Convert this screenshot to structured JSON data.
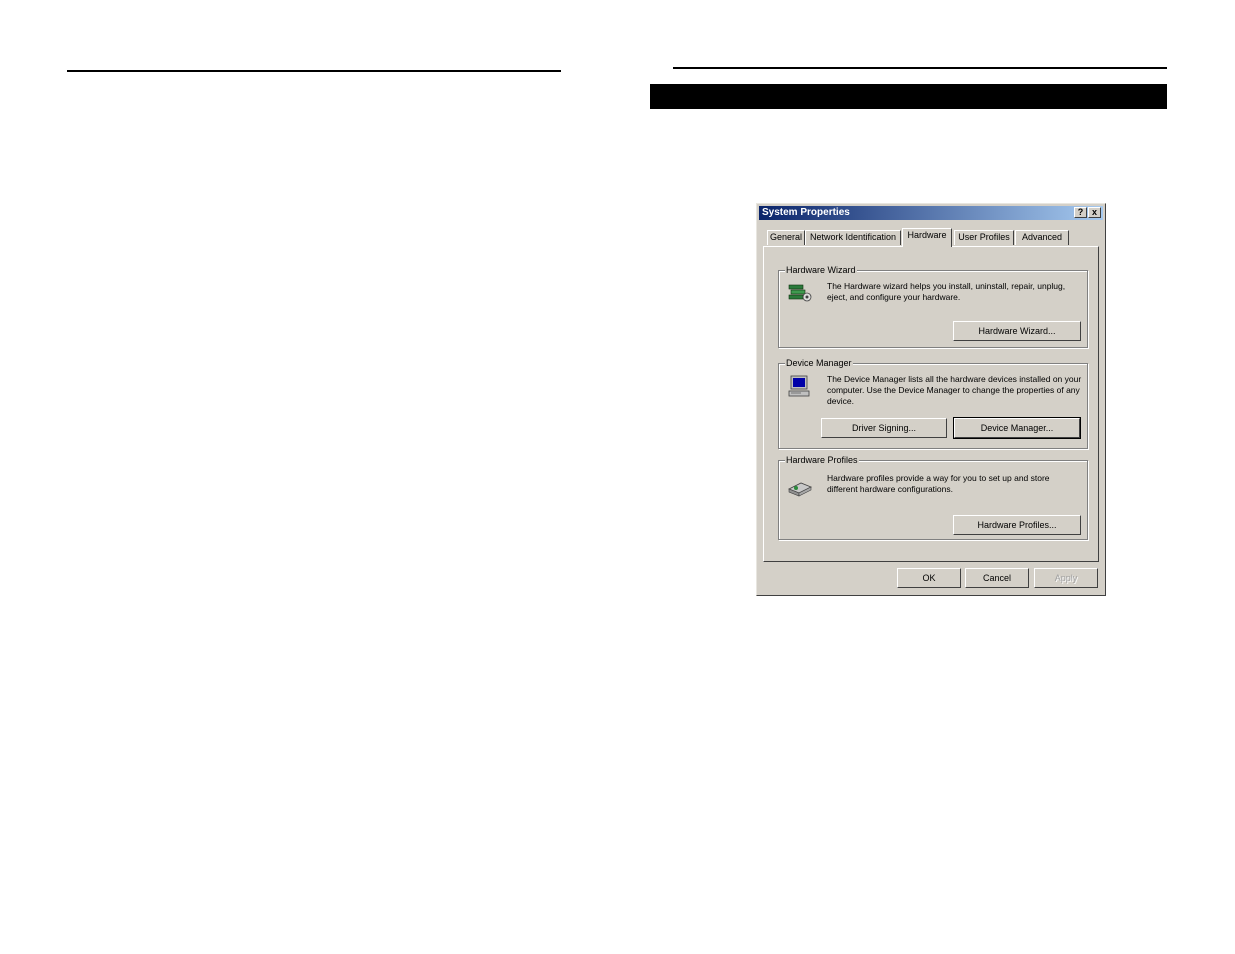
{
  "dialog": {
    "title": "System Properties",
    "help_label": "?",
    "close_label": "x"
  },
  "tabs": [
    "General",
    "Network Identification",
    "Hardware",
    "User Profiles",
    "Advanced"
  ],
  "active_tab": "Hardware",
  "groups": {
    "hardware_wizard": {
      "legend": "Hardware Wizard",
      "description": "The Hardware wizard helps you install, uninstall, repair, unplug, eject, and configure your hardware.",
      "button": "Hardware Wizard..."
    },
    "device_manager": {
      "legend": "Device Manager",
      "description": "The Device Manager lists all the hardware devices installed on your computer. Use the Device Manager to change the properties of any device.",
      "driver_signing_button": "Driver Signing...",
      "device_manager_button": "Device Manager..."
    },
    "hardware_profiles": {
      "legend": "Hardware Profiles",
      "description": "Hardware profiles provide a way for you to set up and store different hardware configurations.",
      "button": "Hardware Profiles..."
    }
  },
  "footer": {
    "ok": "OK",
    "cancel": "Cancel",
    "apply": "Apply"
  },
  "icons": {
    "wizard": "hardware-wizard-icon",
    "device_manager": "computer-icon",
    "profiles": "hardware-profiles-icon"
  }
}
